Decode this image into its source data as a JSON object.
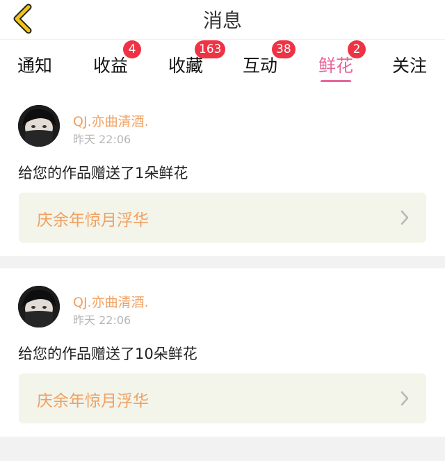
{
  "header": {
    "title": "消息",
    "back_icon": "chevron-left-icon",
    "accent": "#f0c419"
  },
  "tabs": [
    {
      "label": "通知",
      "badge": ""
    },
    {
      "label": "收益",
      "badge": "4"
    },
    {
      "label": "收藏",
      "badge": "163"
    },
    {
      "label": "互动",
      "badge": "38"
    },
    {
      "label": "鲜花",
      "badge": "2",
      "active": true
    },
    {
      "label": "关注",
      "badge": ""
    }
  ],
  "messages": [
    {
      "username": "QJ.亦曲清酒.",
      "time": "昨天 22:06",
      "text": "给您的作品赠送了1朵鲜花",
      "work_title": "庆余年惊月浮华"
    },
    {
      "username": "QJ.亦曲清酒.",
      "time": "昨天 22:06",
      "text": "给您的作品赠送了10朵鲜花",
      "work_title": "庆余年惊月浮华"
    }
  ],
  "colors": {
    "active_tab": "#e8679a",
    "badge": "#ee3344",
    "username": "#f0a060",
    "work_box": "#f3f4ea"
  }
}
